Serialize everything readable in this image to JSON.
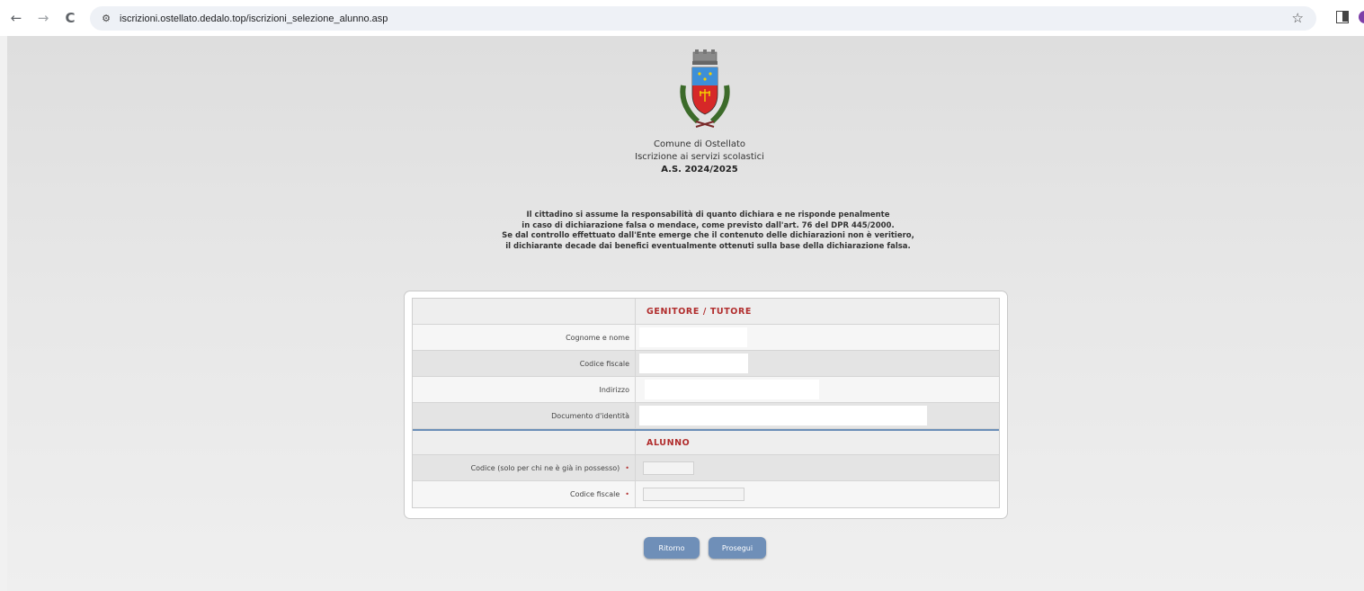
{
  "browser": {
    "url": "iscrizioni.ostellato.dedalo.top/iscrizioni_selezione_alunno.asp",
    "back_icon": "←",
    "forward_icon": "→",
    "reload_icon": "C",
    "star_icon": "☆"
  },
  "header": {
    "line1": "Comune di Ostellato",
    "line2": "Iscrizione ai servizi scolastici",
    "line3": "A.S. 2024/2025"
  },
  "disclaimer": [
    "Il cittadino si assume la responsabilità di quanto dichiara e ne risponde penalmente",
    "in caso di dichiarazione falsa o mendace, come previsto dall'art. 76 del DPR 445/2000.",
    "Se dal controllo effettuato dall'Ente emerge che il contenuto delle dichiarazioni non è veritiero,",
    "il dichiarante decade dai benefici eventualmente ottenuti sulla base della dichiarazione falsa."
  ],
  "form": {
    "section_parent": "GENITORE / TUTORE",
    "label_name": "Cognome e nome",
    "label_cf": "Codice fiscale",
    "label_address": "Indirizzo",
    "label_document": "Documento d'identità",
    "section_student": "ALUNNO",
    "label_student_code": "Codice (solo per chi ne è già in possesso)",
    "label_student_cf": "Codice fiscale",
    "required_mark": "•"
  },
  "buttons": {
    "back": "Ritorno",
    "next": "Prosegui"
  }
}
